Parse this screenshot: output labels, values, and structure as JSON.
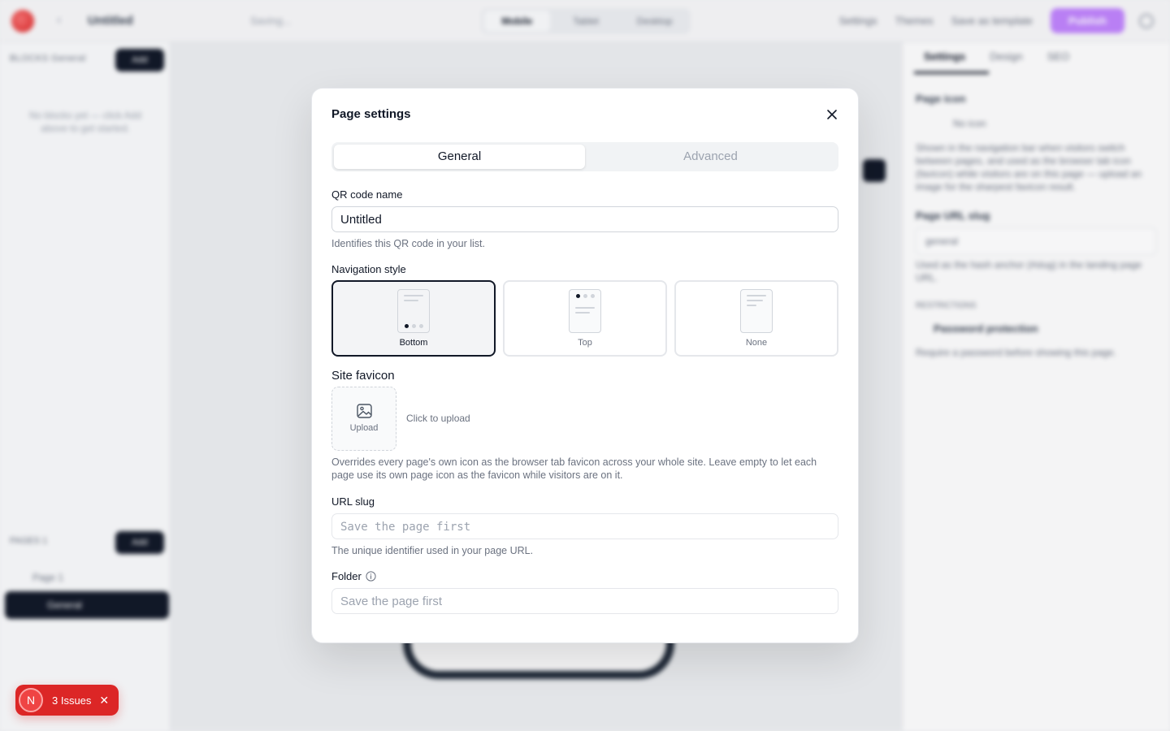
{
  "background": {
    "doc_title": "Untitled",
    "saving": "Saving...",
    "devices": [
      "Mobile",
      "Tablet",
      "Desktop"
    ],
    "actions": [
      "Settings",
      "Themes",
      "Save as template",
      "Publish"
    ],
    "left_tabs": "BLOCKS  General",
    "add": "Add",
    "empty": "No blocks yet — click Add above to get started.",
    "pages_label": "PAGES  1",
    "page1": "Page 1",
    "general": "General",
    "rp_tabs": [
      "Settings",
      "Design",
      "SEO"
    ],
    "rp_page_icon": "Page icon",
    "rp_no_icon": "No icon",
    "rp_icon_text": "Shown in the navigation bar when visitors switch between pages, and used as the browser tab icon (favicon) while visitors are on this page — upload an image for the sharpest favicon result.",
    "rp_slug": "Page URL slug",
    "rp_slug_val": "general",
    "rp_slug_hint": "Used as the hash anchor (#slug) in the landing page URL.",
    "rp_restrict": "RESTRICTIONS",
    "rp_password": "Password protection",
    "rp_password_hint": "Require a password before showing this page."
  },
  "modal": {
    "title": "Page settings",
    "tabs": [
      "General",
      "Advanced"
    ],
    "qr_label": "QR code name",
    "qr_value": "Untitled",
    "qr_hint": "Identifies this QR code in your list.",
    "nav_label": "Navigation style",
    "nav_options": [
      "Bottom",
      "Top",
      "None"
    ],
    "nav_selected": "Bottom",
    "favicon_label": "Site favicon",
    "upload_label": "Upload",
    "click_upload": "Click to upload",
    "favicon_hint": "Overrides every page's own icon as the browser tab favicon across your whole site. Leave empty to let each page use its own page icon as the favicon while visitors are on it.",
    "slug_label": "URL slug",
    "slug_placeholder": "Save the page first",
    "slug_hint": "The unique identifier used in your page URL.",
    "folder_label": "Folder",
    "folder_placeholder": "Save the page first"
  },
  "issues": {
    "avatar": "N",
    "label": "3 Issues"
  },
  "colors": {
    "accent": "#111827",
    "danger": "#dc2626",
    "publish": "#c084fc"
  }
}
